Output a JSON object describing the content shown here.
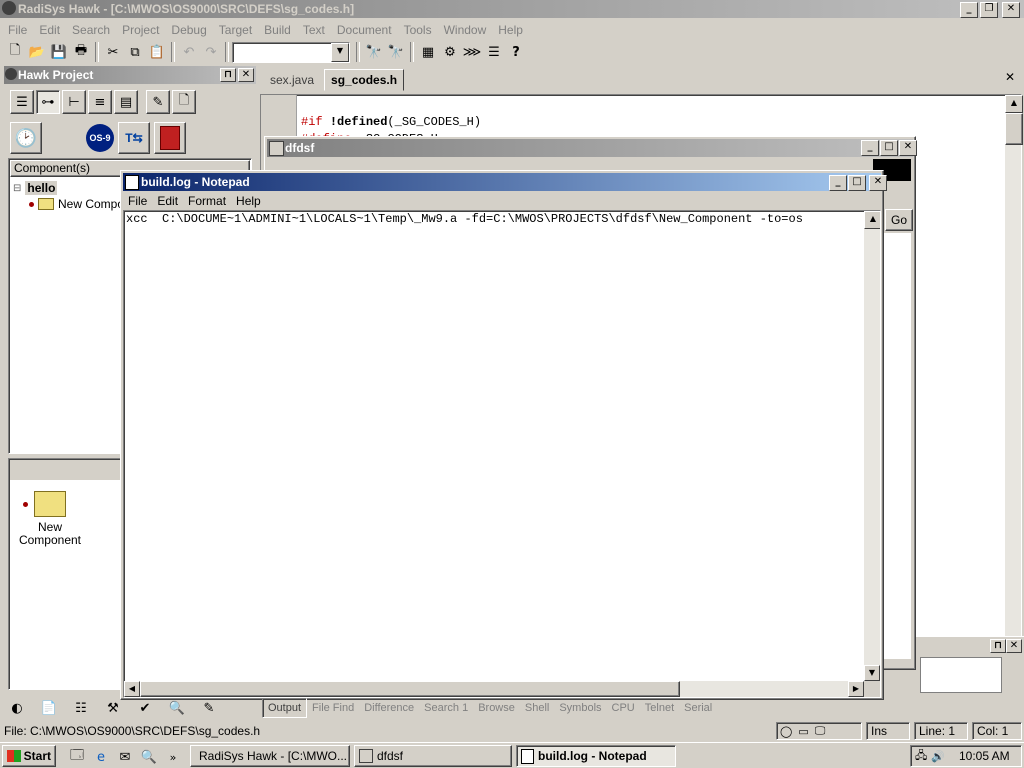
{
  "app": {
    "title": "RadiSys Hawk - [C:\\MWOS\\OS9000\\SRC\\DEFS\\sg_codes.h]",
    "menu": [
      "File",
      "Edit",
      "Search",
      "Project",
      "Debug",
      "Target",
      "Build",
      "Text",
      "Document",
      "Tools",
      "Window",
      "Help"
    ]
  },
  "project_panel": {
    "title": "Hawk Project",
    "os9_label": "OS-9",
    "tree_header": "Component(s)",
    "tree_root": "hello",
    "tree_child": "New Compo",
    "bottom_item": "New Component"
  },
  "editor": {
    "tabs": [
      "sex.java",
      "sg_codes.h"
    ],
    "active_tab": "sg_codes.h",
    "lines": [
      {
        "kw": "#if",
        "kw2": "!defined",
        "rest": "(_SG_CODES_H)"
      },
      {
        "kw": "#define",
        "kw2": "",
        "rest": " _SG_CODES_H"
      }
    ]
  },
  "dfdsf_window": {
    "title": "dfdsf",
    "go_label": "Go"
  },
  "notepad": {
    "title": "build.log - Notepad",
    "menu": [
      "File",
      "Edit",
      "Format",
      "Help"
    ],
    "content": "xcc  C:\\DOCUME~1\\ADMINI~1\\LOCALS~1\\Temp\\_Mw9.a -fd=C:\\MWOS\\PROJECTS\\dfdsf\\New_Component -to=os"
  },
  "output_tabs": [
    "Output",
    "File Find",
    "Difference",
    "Search 1",
    "Browse",
    "Shell",
    "Symbols",
    "CPU",
    "Telnet",
    "Serial"
  ],
  "status": {
    "path": "File: C:\\MWOS\\OS9000\\SRC\\DEFS\\sg_codes.h",
    "ins": "Ins",
    "line": "Line: 1",
    "col": "Col: 1"
  },
  "taskbar": {
    "start": "Start",
    "buttons": [
      "RadiSys Hawk - [C:\\MWO...",
      "dfdsf",
      "build.log - Notepad"
    ],
    "clock": "10:05 AM"
  },
  "colors": {
    "active_title": "#0a246a",
    "inactive_title": "#808080",
    "keyword": "#c00000"
  }
}
